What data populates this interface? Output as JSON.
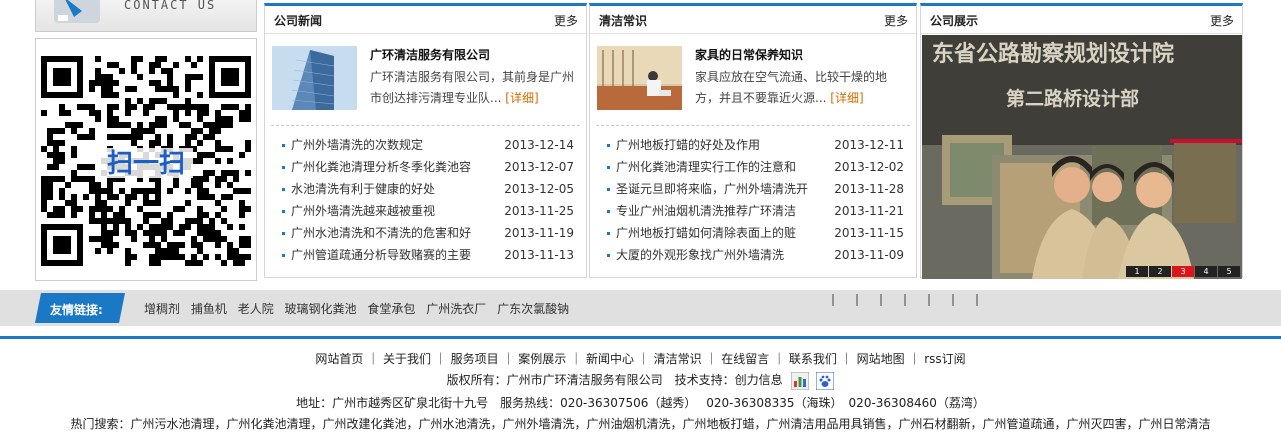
{
  "sidebar": {
    "contact_label": "CONTACT US",
    "qr_label": "扫一扫"
  },
  "panels": [
    {
      "title": "公司新闻",
      "more": "更多",
      "feature": {
        "title": "广环清洁服务有限公司",
        "text": "广环清洁服务有限公司，其前身是广州市创达排污清理专业队...",
        "more": "[详细]"
      },
      "items": [
        {
          "title": "广州外墙清洗的次数规定",
          "date": "2013-12-14"
        },
        {
          "title": "广州化粪池清理分析冬季化粪池容",
          "date": "2013-12-07"
        },
        {
          "title": "水池清洗有利于健康的好处",
          "date": "2013-12-05"
        },
        {
          "title": "广州外墙清洗越来越被重视",
          "date": "2013-11-25"
        },
        {
          "title": "广州水池清洗和不清洗的危害和好",
          "date": "2013-11-19"
        },
        {
          "title": "广州管道疏通分析导致赌赛的主要",
          "date": "2013-11-13"
        }
      ]
    },
    {
      "title": "清洁常识",
      "more": "更多",
      "feature": {
        "title": "家具的日常保养知识",
        "text": "家具应放在空气流通、比较干燥的地方，并且不要靠近火源...",
        "more": "[详细]"
      },
      "items": [
        {
          "title": "广州地板打蜡的好处及作用",
          "date": "2013-12-11"
        },
        {
          "title": "广州化粪池清理实行工作的注意和",
          "date": "2013-12-02"
        },
        {
          "title": "圣诞元旦即将来临，广州外墙清洗开",
          "date": "2013-11-28"
        },
        {
          "title": "专业广州油烟机清洗推荐广环清洁",
          "date": "2013-11-21"
        },
        {
          "title": "广州地板打蜡如何清除表面上的赃",
          "date": "2013-11-15"
        },
        {
          "title": "大厦的外观形象找广州外墙清洗",
          "date": "2013-11-09"
        }
      ]
    },
    {
      "title": "公司展示",
      "more": "更多",
      "photo_sign_1": "东省公路勘察规划设计院",
      "photo_sign_2": "第二路桥设计部",
      "pager": [
        "1",
        "2",
        "3",
        "4",
        "5"
      ],
      "active_page": "3"
    }
  ],
  "friend_links": {
    "label": "友情链接:",
    "links": [
      "增稠剂",
      "捕鱼机",
      "老人院",
      "玻璃钢化粪池",
      "食堂承包",
      "广州洗衣厂",
      "广东次氯酸钠"
    ]
  },
  "footer": {
    "nav": [
      "网站首页",
      "关于我们",
      "服务项目",
      "案例展示",
      "新闻中心",
      "清洁常识",
      "在线留言",
      "联系我们",
      "网站地图",
      "rss订阅"
    ],
    "copyright": "版权所有：广州市广环清洁服务有限公司　技术支持：创力信息",
    "address": "地址：广州市越秀区矿泉北街十九号　服务热线：020-36307506（越秀）　 020-36308335（海珠）　020-36308460（荔湾）",
    "hot": "热门搜索：广州污水池清理，广州化粪池清理，广州改建化粪池，广州水池清洗，广州外墙清洗，广州油烟机清洗，广州地板打蜡，广州清洁用品用具销售，广州石材翻新，广州管道疏通，广州灭四害，广州日常清洁"
  },
  "colors": {
    "accent": "#1b78c4",
    "more_link": "#d96b00",
    "pager_active": "#d9161c"
  }
}
